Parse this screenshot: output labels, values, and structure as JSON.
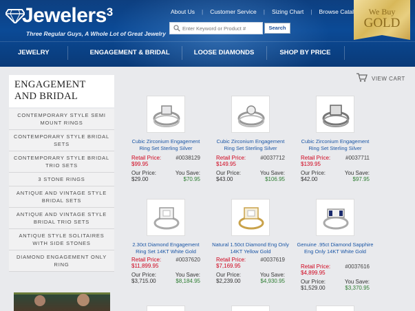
{
  "header": {
    "brand": "Jewelers",
    "brand_sup": "3",
    "tagline": "Three Regular Guys, A Whole Lot of Great Jewelry",
    "top_links": [
      "About Us",
      "Customer Service",
      "Sizing Chart",
      "Browse Catalog"
    ],
    "search_placeholder": "Enter Keyword or Product #",
    "search_button": "Search",
    "badge_line1": "We Buy",
    "badge_line2": "GOLD",
    "nav": [
      "JEWELRY",
      "ENGAGEMENT & BRIDAL",
      "LOOSE DIAMONDS",
      "SHOP BY PRICE"
    ]
  },
  "cart": {
    "label": "VIEW CART"
  },
  "sidebar": {
    "title": "ENGAGEMENT AND BRIDAL",
    "categories": [
      "CONTEMPORARY STYLE SEMI MOUNT RINGS",
      "CONTEMPORARY STYLE BRIDAL SETS",
      "CONTEMPORARY STYLE BRIDAL TRIO SETS",
      "3 STONE RINGS",
      "ANTIQUE AND VINTAGE STYLE BRIDAL SETS",
      "ANTIQUE AND VINTAGE STYLE BRIDAL TRIO SETS",
      "ANTIQUE STYLE SOLITAIRES WITH SIDE STONES",
      "DIAMOND ENGAGEMENT ONLY RING"
    ]
  },
  "labels": {
    "retail": "Retail Price:",
    "our": "Our Price:",
    "save": "You Save:"
  },
  "products": [
    {
      "name": "Cubic Zirconium Engagement Ring Set Sterling Silver",
      "retail": "$99.95",
      "sku": "#0038129",
      "our": "$29.00",
      "save": "$70.95"
    },
    {
      "name": "Cubic Zirconium Engagement Ring Set Sterling Silver",
      "retail": "$149.95",
      "sku": "#0037712",
      "our": "$43.00",
      "save": "$106.95"
    },
    {
      "name": "Cubic Zirconium Engagement Ring Set Sterling Silver",
      "retail": "$139.95",
      "sku": "#0037711",
      "our": "$42.00",
      "save": "$97.95"
    },
    {
      "name": "2.30ct Diamond Engagement Ring Set 14KT White Gold",
      "retail": "$11,899.95",
      "sku": "#0037620",
      "our": "$3,715.00",
      "save": "$8,184.95"
    },
    {
      "name": "Natural 1.50ct Diamond Eng Only 14KT Yellow Gold",
      "retail": "$7,169.95",
      "sku": "#0037619",
      "our": "$2,239.00",
      "save": "$4,930.95"
    },
    {
      "name": "Genuine .95ct Diamond Sapphire Eng Only 14KT White Gold",
      "retail": "$4,899.95",
      "sku": "#0037616",
      "our": "$1,529.00",
      "save": "$3,370.95"
    }
  ]
}
